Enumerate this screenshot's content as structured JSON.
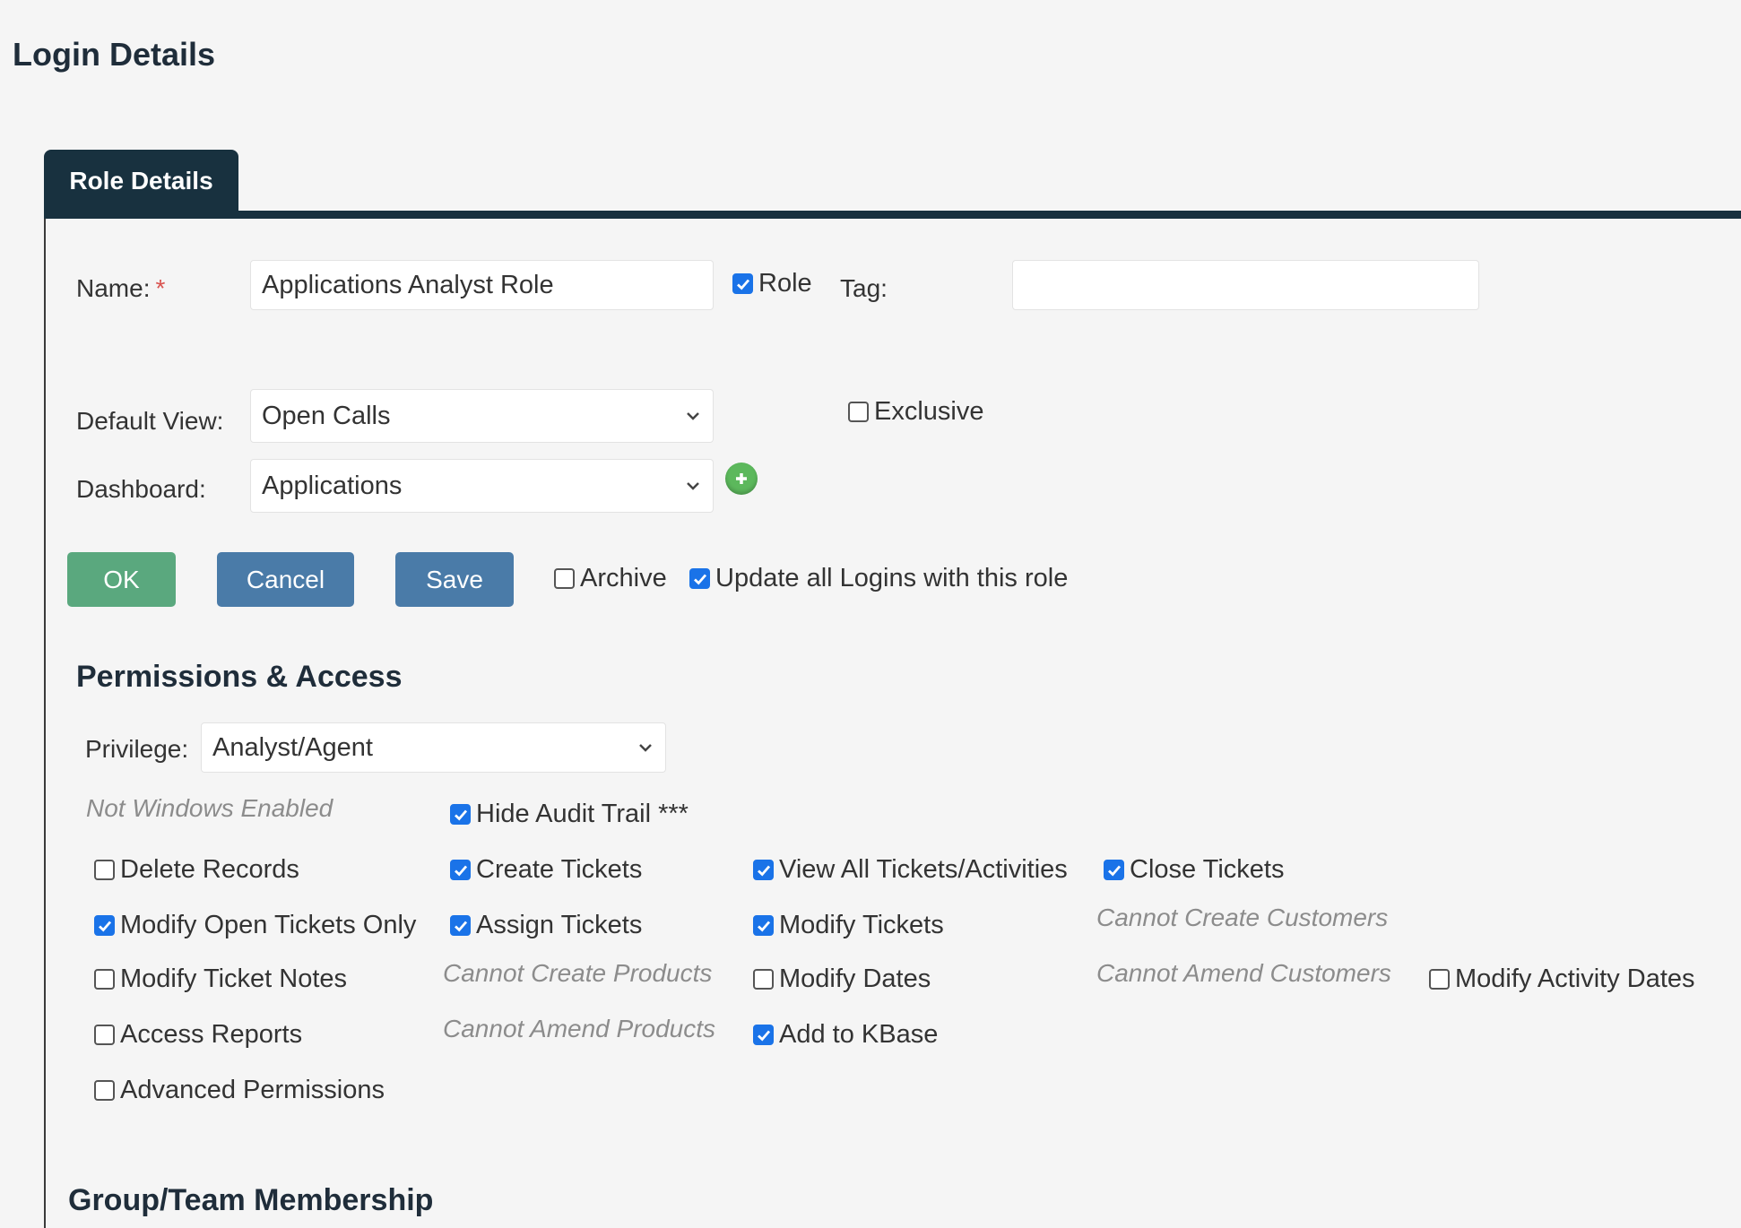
{
  "page": {
    "title": "Login Details"
  },
  "tabs": [
    {
      "label": "Role Details"
    }
  ],
  "form": {
    "name_label": "Name:",
    "required_mark": "*",
    "name_value": "Applications Analyst Role",
    "role_checkbox": {
      "label": "Role",
      "checked": true
    },
    "tag_label": "Tag:",
    "tag_value": "",
    "default_view_label": "Default View:",
    "default_view_value": "Open Calls",
    "exclusive_checkbox": {
      "label": "Exclusive",
      "checked": false
    },
    "dashboard_label": "Dashboard:",
    "dashboard_value": "Applications"
  },
  "actions": {
    "ok_label": "OK",
    "cancel_label": "Cancel",
    "save_label": "Save",
    "archive": {
      "label": "Archive",
      "checked": false
    },
    "update_all": {
      "label": "Update all Logins with this role",
      "checked": true
    }
  },
  "permissions": {
    "title": "Permissions & Access",
    "privilege_label": "Privilege:",
    "privilege_value": "Analyst/Agent",
    "note_not_windows": "Not Windows Enabled",
    "hide_audit": {
      "label": "Hide Audit Trail ***",
      "checked": true
    },
    "delete_records": {
      "label": "Delete Records",
      "checked": false
    },
    "create_tickets": {
      "label": "Create Tickets",
      "checked": true
    },
    "view_all": {
      "label": "View All Tickets/Activities",
      "checked": true
    },
    "close_tickets": {
      "label": "Close Tickets",
      "checked": true
    },
    "modify_open_only": {
      "label": "Modify Open Tickets Only",
      "checked": true
    },
    "assign_tickets": {
      "label": "Assign Tickets",
      "checked": true
    },
    "modify_tickets": {
      "label": "Modify Tickets",
      "checked": true
    },
    "note_cannot_create_customers": "Cannot Create Customers",
    "modify_ticket_notes": {
      "label": "Modify Ticket Notes",
      "checked": false
    },
    "note_cannot_create_products": "Cannot Create Products",
    "modify_dates": {
      "label": "Modify Dates",
      "checked": false
    },
    "note_cannot_amend_customers": "Cannot Amend Customers",
    "modify_activity_dates": {
      "label": "Modify Activity Dates",
      "checked": false
    },
    "access_reports": {
      "label": "Access Reports",
      "checked": false
    },
    "note_cannot_amend_products": "Cannot Amend Products",
    "add_to_kbase": {
      "label": "Add to KBase",
      "checked": true
    },
    "advanced_permissions": {
      "label": "Advanced Permissions",
      "checked": false
    }
  },
  "group": {
    "title": "Group/Team Membership"
  },
  "icons": {
    "dropdown": "chevron-down-icon",
    "add": "add-circle-icon",
    "check": "checkmark-icon"
  },
  "colors": {
    "tab_bg": "#18313f",
    "ok_button": "#5aa87e",
    "action_button": "#4a7ba8",
    "checkbox_checked": "#1a73e8",
    "required": "#d9534f",
    "add_icon": "#5cb85c"
  }
}
